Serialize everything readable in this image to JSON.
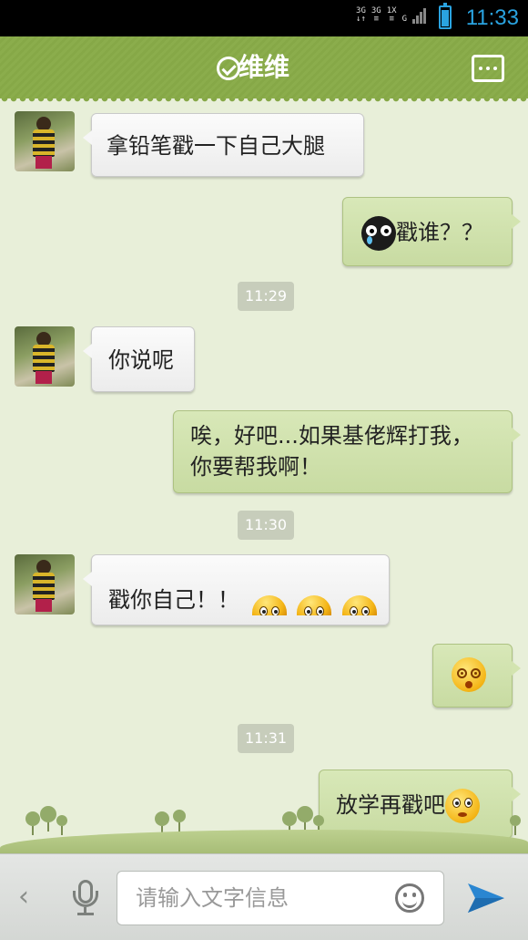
{
  "status_bar": {
    "network_1": "3G",
    "network_2": "3G",
    "network_3": "1X",
    "network_4": "G",
    "time": "11:33",
    "battery_level": 0.8,
    "accent_color": "#2aa3e0"
  },
  "header": {
    "title": "维维",
    "verified_icon": "check-circle-icon",
    "more_icon": "more-dots-icon",
    "bg_color": "#8bad4c"
  },
  "messages": [
    {
      "side": "left",
      "text": "拿铅笔戳一下自己大腿"
    },
    {
      "side": "right",
      "emoji_before": "crying-ghost-emoji",
      "text": "戳谁？？"
    },
    {
      "type": "time",
      "text": "11:29"
    },
    {
      "side": "left",
      "text": "你说呢"
    },
    {
      "side": "right",
      "text": "唉，好吧...如果基佬辉打我，你要帮我啊！"
    },
    {
      "type": "time",
      "text": "11:30"
    },
    {
      "side": "left",
      "text": "戳你自己！！",
      "emoji_after": [
        "sweat-emoji",
        "sweat-emoji",
        "sweat-emoji"
      ]
    },
    {
      "side": "right",
      "emoji": "dizzy-emoji"
    },
    {
      "type": "time",
      "text": "11:31"
    },
    {
      "side": "right",
      "text": "放学再戳吧",
      "emoji_after": [
        "worried-emoji"
      ]
    }
  ],
  "input_bar": {
    "back_icon": "chevron-left-icon",
    "mic_icon": "microphone-icon",
    "placeholder": "请输入文字信息",
    "emoji_icon": "smiley-icon",
    "send_icon": "send-icon"
  }
}
